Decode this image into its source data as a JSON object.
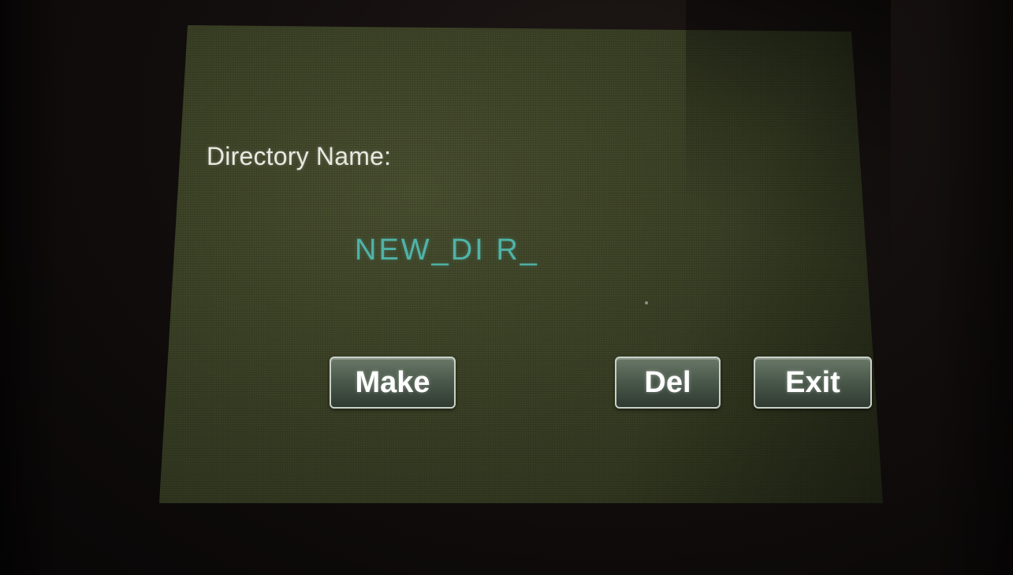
{
  "screen": {
    "label": "Directory Name:",
    "value": "NEW_DI R_"
  },
  "buttons": {
    "make": "Make",
    "del": "Del",
    "exit": "Exit"
  },
  "colors": {
    "lcd_background": "#3d4327",
    "label_text": "#e8e8e0",
    "value_text": "#4fb3a8",
    "button_fill": "#4b5a4c"
  }
}
